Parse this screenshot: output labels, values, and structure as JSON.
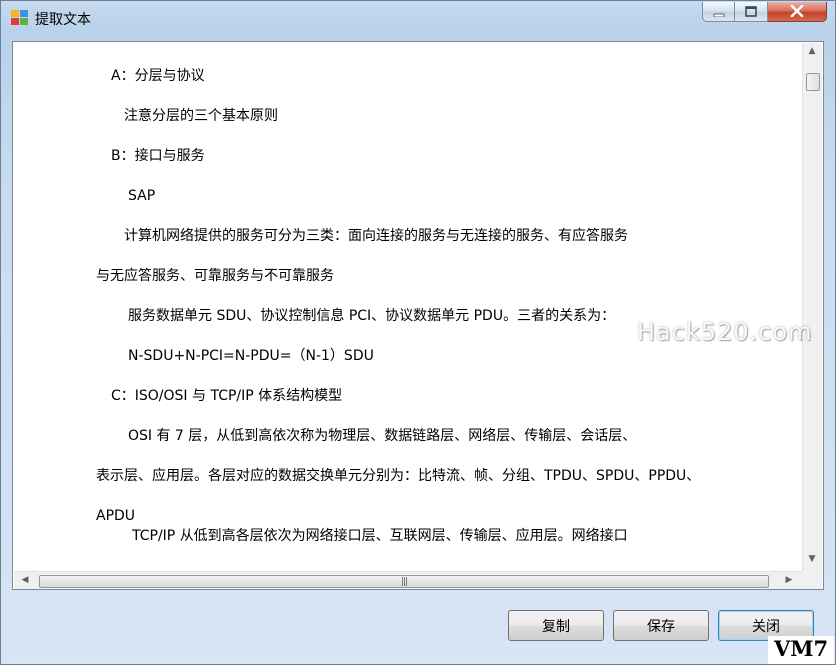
{
  "window": {
    "title": "提取文本",
    "icon": "puzzle-app-icon"
  },
  "controls": {
    "minimize_icon": "minimize-icon",
    "maximize_icon": "maximize-icon",
    "close_icon": "close-icon"
  },
  "content": {
    "lines": [
      "A：分层与协议",
      "注意分层的三个基本原则",
      "B：接口与服务",
      "SAP",
      "计算机网络提供的服务可分为三类：面向连接的服务与无连接的服务、有应答服务",
      "与无应答服务、可靠服务与不可靠服务",
      "服务数据单元 SDU、协议控制信息 PCI、协议数据单元 PDU。三者的关系为：",
      "N-SDU+N-PCI=N-PDU=（N-1）SDU",
      "C：ISO/OSI 与 TCP/IP 体系结构模型",
      "OSI 有 7 层，从低到高依次称为物理层、数据链路层、网络层、传输层、会话层、",
      "表示层、应用层。各层对应的数据交换单元分别为：比特流、帧、分组、TPDU、SPDU、PPDU、",
      "APDU",
      "TCP/IP 从低到高各层依次为网络接口层、互联网层、传输层、应用层。网络接口"
    ]
  },
  "buttons": {
    "copy": "复制",
    "save": "保存",
    "close": "关闭"
  },
  "watermark": "Hack520.com",
  "corner_logo": "VM7"
}
